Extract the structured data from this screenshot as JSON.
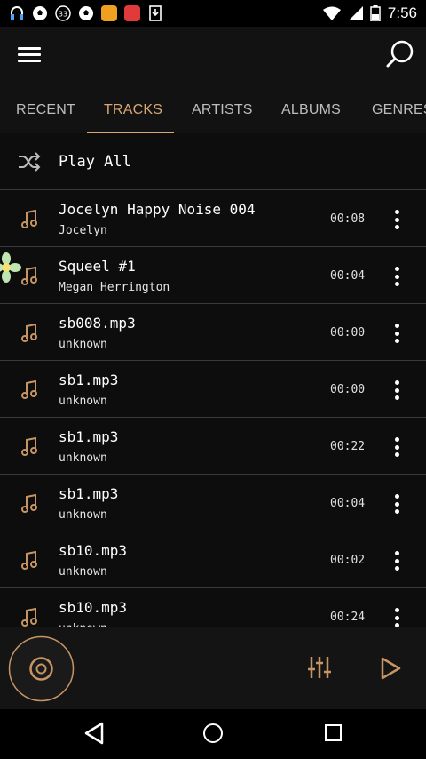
{
  "status_bar": {
    "time": "7:56",
    "notification_icons": [
      "headset-icon",
      "soccer-icon",
      "badge-33-icon",
      "soccer-icon",
      "app-orange-icon",
      "app-red-icon",
      "download-icon"
    ],
    "badge_text": "33"
  },
  "header": {
    "tabs": [
      {
        "label": "RECENT",
        "active": false
      },
      {
        "label": "TRACKS",
        "active": true
      },
      {
        "label": "ARTISTS",
        "active": false
      },
      {
        "label": "ALBUMS",
        "active": false
      },
      {
        "label": "GENRES",
        "active": false
      }
    ]
  },
  "play_all": {
    "label": "Play All"
  },
  "tracks": [
    {
      "title": "Jocelyn Happy Noise 004",
      "artist": "Jocelyn",
      "duration": "00:08"
    },
    {
      "title": "Squeel #1",
      "artist": "Megan Herrington",
      "duration": "00:04"
    },
    {
      "title": "sb008.mp3",
      "artist": "unknown",
      "duration": "00:00"
    },
    {
      "title": "sb1.mp3",
      "artist": "unknown",
      "duration": "00:00"
    },
    {
      "title": "sb1.mp3",
      "artist": "unknown",
      "duration": "00:22"
    },
    {
      "title": "sb1.mp3",
      "artist": "unknown",
      "duration": "00:04"
    },
    {
      "title": "sb10.mp3",
      "artist": "unknown",
      "duration": "00:02"
    },
    {
      "title": "sb10.mp3",
      "artist": "unknown",
      "duration": "00:24"
    }
  ],
  "colors": {
    "accent": "#d9a675",
    "background": "#0d0d0d",
    "divider": "#3a3a3a"
  }
}
